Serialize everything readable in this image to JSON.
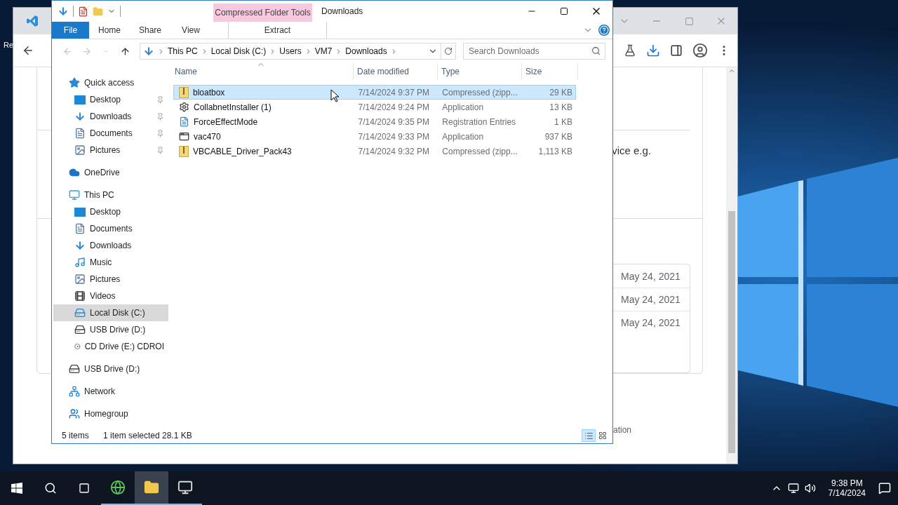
{
  "desktop": {
    "icon_label": "Re"
  },
  "browser": {
    "snippet": "vice e.g.",
    "dates": [
      "May 24, 2021",
      "May 24, 2021",
      "May 24, 2021"
    ],
    "footer_snippet": "ation"
  },
  "explorer": {
    "title": "Downloads",
    "contextual_group": "Compressed Folder Tools",
    "ribbon_tabs": [
      {
        "label": "File",
        "kind": "file"
      },
      {
        "label": "Home",
        "kind": "plain"
      },
      {
        "label": "Share",
        "kind": "plain"
      },
      {
        "label": "View",
        "kind": "plain"
      },
      {
        "label": "Extract",
        "kind": "contextual"
      }
    ],
    "address": [
      "This PC",
      "Local Disk (C:)",
      "Users",
      "VM7",
      "Downloads"
    ],
    "search": {
      "placeholder": "Search Downloads"
    },
    "columns": [
      "Name",
      "Date modified",
      "Type",
      "Size"
    ],
    "files": [
      {
        "name": "bloatbox",
        "date": "7/14/2024 9:37 PM",
        "type": "Compressed (zipp...",
        "size": "29 KB",
        "kind": "zip",
        "selected": true
      },
      {
        "name": "CollabnetInstaller (1)",
        "date": "7/14/2024 9:24 PM",
        "type": "Application",
        "size": "13 KB",
        "kind": "installer",
        "selected": false
      },
      {
        "name": "ForceEffectMode",
        "date": "7/14/2024 9:35 PM",
        "type": "Registration Entries",
        "size": "1 KB",
        "kind": "reg",
        "selected": false
      },
      {
        "name": "vac470",
        "date": "7/14/2024 9:33 PM",
        "type": "Application",
        "size": "937 KB",
        "kind": "app",
        "selected": false
      },
      {
        "name": "VBCABLE_Driver_Pack43",
        "date": "7/14/2024 9:32 PM",
        "type": "Compressed (zipp...",
        "size": "1,113 KB",
        "kind": "zip",
        "selected": false
      }
    ],
    "nav": [
      {
        "label": "Quick access",
        "kind": "star",
        "selected": false,
        "pinned": false,
        "children": [
          {
            "label": "Desktop",
            "kind": "desktop",
            "selected": false,
            "pinned": true
          },
          {
            "label": "Downloads",
            "kind": "download",
            "selected": false,
            "pinned": true
          },
          {
            "label": "Documents",
            "kind": "documents",
            "selected": false,
            "pinned": true
          },
          {
            "label": "Pictures",
            "kind": "pictures",
            "selected": false,
            "pinned": true
          }
        ]
      },
      {
        "label": "OneDrive",
        "kind": "cloud",
        "selected": false,
        "pinned": false
      },
      {
        "label": "This PC",
        "kind": "pc",
        "selected": false,
        "pinned": false,
        "children": [
          {
            "label": "Desktop",
            "kind": "desktop",
            "selected": false,
            "pinned": false
          },
          {
            "label": "Documents",
            "kind": "documents",
            "selected": false,
            "pinned": false
          },
          {
            "label": "Downloads",
            "kind": "download",
            "selected": false,
            "pinned": false
          },
          {
            "label": "Music",
            "kind": "music",
            "selected": false,
            "pinned": false
          },
          {
            "label": "Pictures",
            "kind": "pictures",
            "selected": false,
            "pinned": false
          },
          {
            "label": "Videos",
            "kind": "videos",
            "selected": false,
            "pinned": false
          },
          {
            "label": "Local Disk (C:)",
            "kind": "disk",
            "selected": true,
            "pinned": false
          },
          {
            "label": "USB Drive (D:)",
            "kind": "usb",
            "selected": false,
            "pinned": false
          },
          {
            "label": "CD Drive (E:) CDROI",
            "kind": "cd",
            "selected": false,
            "pinned": false
          }
        ]
      },
      {
        "label": "USB Drive (D:)",
        "kind": "usb",
        "selected": false,
        "pinned": false
      },
      {
        "label": "Network",
        "kind": "network",
        "selected": false,
        "pinned": false
      },
      {
        "label": "Homegroup",
        "kind": "homegroup",
        "selected": false,
        "pinned": false
      }
    ],
    "status": {
      "count": "5 items",
      "selection": "1 item selected",
      "size": "28.1 KB"
    }
  },
  "taskbar": {
    "apps": [
      {
        "kind": "browser",
        "selected": false
      },
      {
        "kind": "explorer",
        "selected": true
      },
      {
        "kind": "monitor",
        "selected": false
      }
    ],
    "time": "9:38 PM",
    "date": "7/14/2024"
  }
}
